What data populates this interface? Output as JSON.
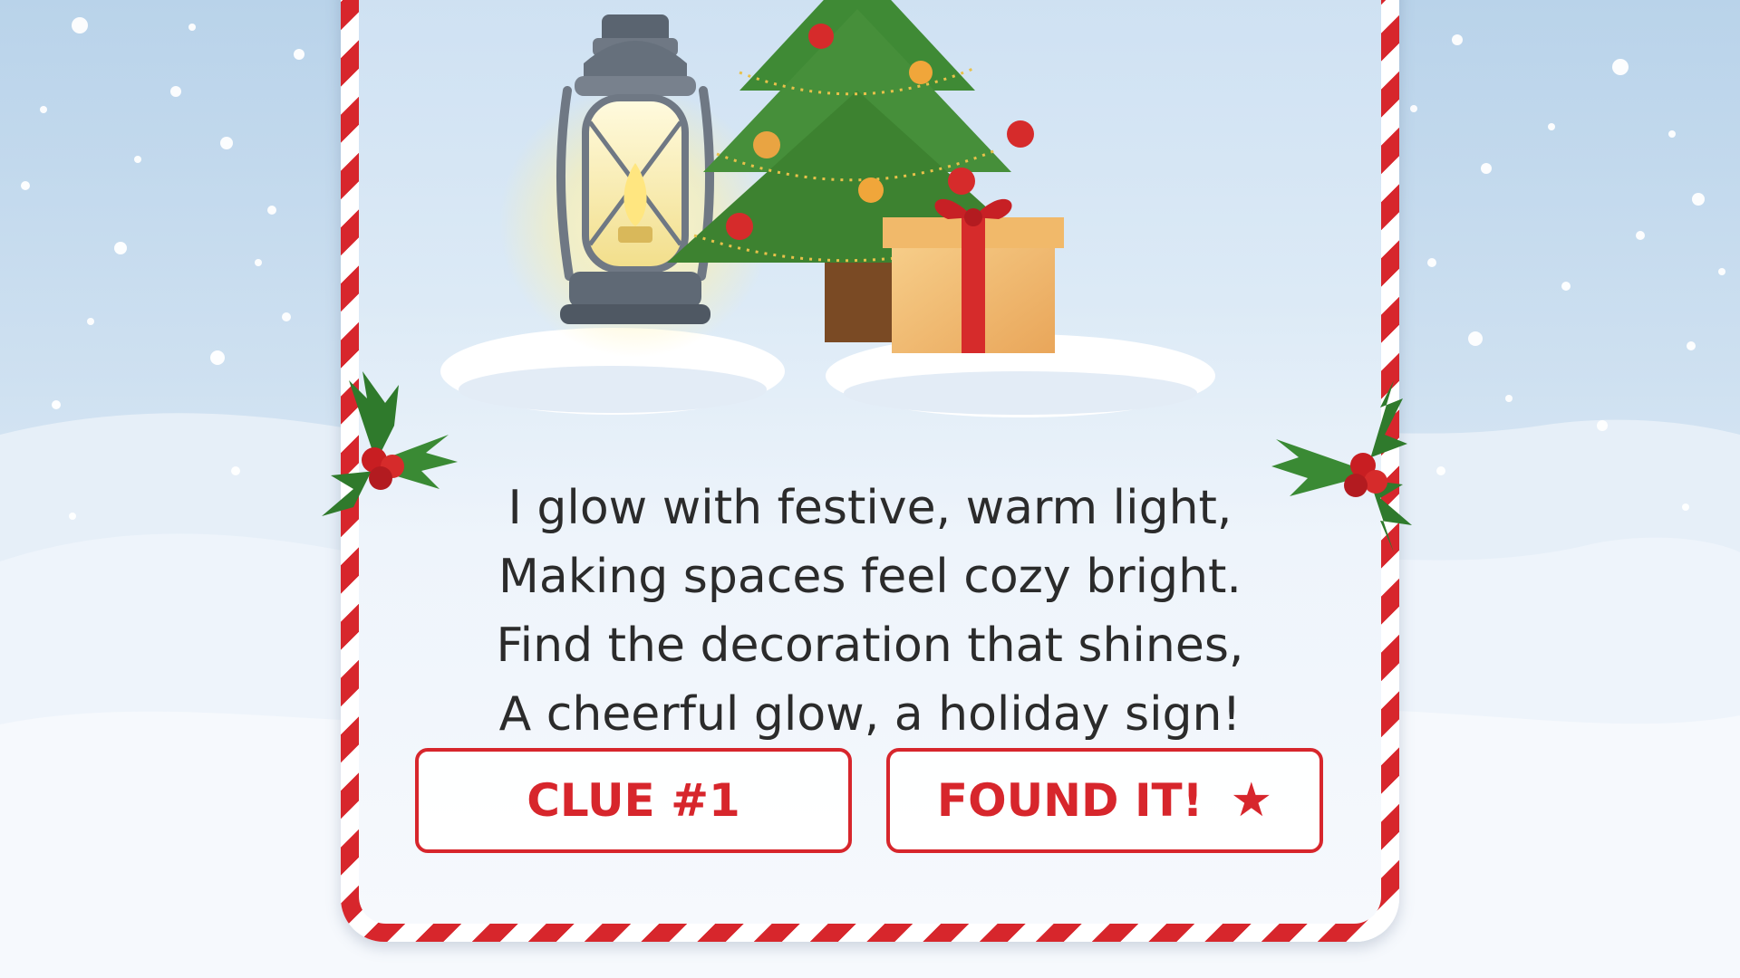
{
  "riddle": {
    "lines": [
      "I glow with festive, warm light,",
      "Making spaces feel cozy bright.",
      "Find the decoration that shines,",
      "A cheerful glow, a holiday sign!"
    ]
  },
  "buttons": {
    "clue_label": "CLUE #1",
    "found_label": "FOUND IT!",
    "found_icon": "★"
  },
  "colors": {
    "accent_red": "#d7262c",
    "sky_blue": "#b9d3ea",
    "text_dark": "#2b2b2b"
  },
  "icons": {
    "lantern": "lantern-icon",
    "tree": "christmas-tree-icon",
    "gift": "gift-box-icon",
    "holly": "holly-icon",
    "star": "star-icon"
  }
}
